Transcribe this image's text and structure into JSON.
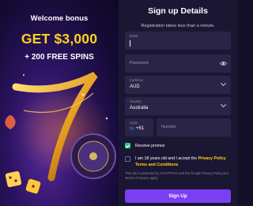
{
  "promo": {
    "heading": "Welcome bonus",
    "amount": "GET $3,000",
    "spins": "+ 200 FREE SPINS"
  },
  "form": {
    "title": "Sign up Details",
    "subtitle": "Registration takes less than a minute.",
    "email": {
      "label": "Email",
      "value": ""
    },
    "password": {
      "placeholder": "Password"
    },
    "currency": {
      "label": "Currency",
      "value": "AUD"
    },
    "country": {
      "label": "Country",
      "value": "Australia"
    },
    "code": {
      "label": "Code",
      "value": "+61"
    },
    "number": {
      "placeholder": "Number"
    },
    "receive_promos": {
      "label": "Receive promos",
      "checked": true
    },
    "terms": {
      "prefix": "I am 18 years old and I accept the ",
      "privacy": "Privacy Policy",
      "middle": " and ",
      "terms": "Terms and Conditions"
    },
    "captcha_note": "This site is protected by reCAPTCHA and the Google Privacy Policy and Terms of Service apply.",
    "submit_label": "Sign Up"
  },
  "colors": {
    "accent_yellow": "#ffd21f",
    "button_purple": "#7b3ff2",
    "check_green": "#2fc98b",
    "panel_bg": "#1b1733",
    "field_bg": "#2a2547"
  },
  "icons": [
    "eye-icon",
    "chevron-down-icon",
    "australia-flag-icon",
    "checkmark-icon"
  ]
}
